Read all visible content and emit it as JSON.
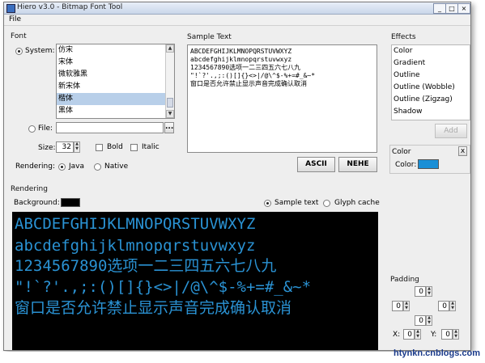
{
  "window": {
    "title": "Hiero v3.0 - Bitmap Font Tool",
    "controls": [
      "_",
      "□",
      "×"
    ]
  },
  "menu": {
    "file": "File"
  },
  "font": {
    "section": "Font",
    "system_label": "System:",
    "fonts": [
      "仿宋",
      "宋体",
      "微软雅黑",
      "新宋体",
      "楷体",
      "黑体"
    ],
    "selected_index": 4,
    "file_label": "File:",
    "file_value": "",
    "browse_label": "...",
    "size_label": "Size:",
    "size_value": "32",
    "bold_label": "Bold",
    "italic_label": "Italic",
    "rendering_label": "Rendering:",
    "java_label": "Java",
    "native_label": "Native"
  },
  "sample": {
    "section": "Sample Text",
    "lines": [
      "ABCDEFGHIJKLMNOPQRSTUVWXYZ",
      "abcdefghijklmnopqrstuvwxyz",
      "1234567890选项一二三四五六七八九",
      "\"!`?'.,;:()[]{}<>|/@\\^$-%+=#_&~*",
      "窗口是否允许禁止显示声音完成确认取消"
    ],
    "ascii_button": "ASCII",
    "nehe_button": "NEHE"
  },
  "effects": {
    "section": "Effects",
    "items": [
      "Color",
      "Gradient",
      "Outline",
      "Outline (Wobble)",
      "Outline (Zigzag)",
      "Shadow"
    ],
    "add_button": "Add",
    "color_panel_title": "Color",
    "color_label": "Color:",
    "color_value": "#1a8fd6",
    "close_label": "x"
  },
  "rendering": {
    "section": "Rendering",
    "background_label": "Background:",
    "background_color": "#000000",
    "sample_text_label": "Sample text",
    "glyph_cache_label": "Glyph cache",
    "text_color": "#2a92d3"
  },
  "padding": {
    "section": "Padding",
    "top": "0",
    "left": "0",
    "right": "0",
    "bottom": "0",
    "x_label": "X:",
    "x_value": "0",
    "y_label": "Y:",
    "y_value": "0"
  },
  "watermark": "htynkn.cnblogs.com"
}
